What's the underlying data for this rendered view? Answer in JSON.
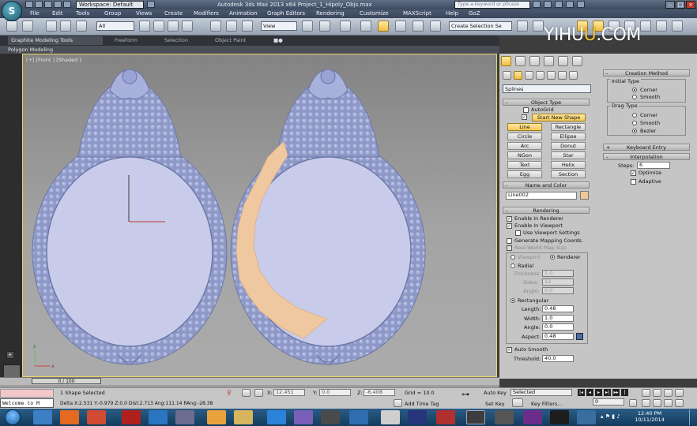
{
  "titlebar": {
    "workspace": "Workspace: Default",
    "app_title": "Autodesk 3ds Max 2013 x64      Project_1_Hipoly_Objs.max",
    "search_placeholder": "Type a keyword or phrase",
    "win_min": "–",
    "win_max": "□",
    "win_close": "×"
  },
  "menu": [
    "File",
    "Edit",
    "Tools",
    "Group",
    "Views",
    "Create",
    "Modifiers",
    "Animation",
    "Graph Editors",
    "Rendering",
    "Customize",
    "MAXScript",
    "Help",
    "GoZ"
  ],
  "toolbar": {
    "filter": "All",
    "ref_coord": "View",
    "selection_set": "Create Selection Se"
  },
  "ribbon": {
    "tabs": [
      "Graphite Modeling Tools",
      "Freeform",
      "Selection",
      "Object Paint"
    ],
    "sub": "Polygon Modeling"
  },
  "viewport": {
    "label": "[+] [Front ] [Shaded ]"
  },
  "cmd": {
    "category": "Splines",
    "object_type": {
      "title": "Object Type",
      "autogrid": "AutoGrid",
      "start_new_shape": "Start New Shape",
      "buttons": [
        [
          "Line",
          "Rectangle"
        ],
        [
          "Circle",
          "Ellipse"
        ],
        [
          "Arc",
          "Donut"
        ],
        [
          "NGon",
          "Star"
        ],
        [
          "Text",
          "Helix"
        ],
        [
          "Egg",
          "Section"
        ]
      ]
    },
    "name_color": {
      "title": "Name and Color",
      "name": "Line002",
      "color": "#f2c89a"
    },
    "rendering": {
      "title": "Rendering",
      "enable_renderer": "Enable In Renderer",
      "enable_viewport": "Enable In Viewport",
      "use_viewport_settings": "Use Viewport Settings",
      "gen_mapping": "Generate Mapping Coords.",
      "real_world": "Real-World Map Size",
      "viewport_opt": "Viewport",
      "renderer_opt": "Renderer",
      "radial": "Radial",
      "thickness_label": "Thickness:",
      "thickness": "1.0",
      "sides_label": "Sides:",
      "sides": "12",
      "angle_label": "Angle:",
      "angle": "0.0",
      "rectangular": "Rectangular",
      "length_label": "Length:",
      "length": "0.48",
      "width_label": "Width:",
      "width": "1.0",
      "rangle_label": "Angle:",
      "rangle": "0.0",
      "aspect_label": "Aspect:",
      "aspect": "0.48",
      "auto_smooth": "Auto Smooth",
      "threshold_label": "Threshold:",
      "threshold": "40.0"
    },
    "creation_method": {
      "title": "Creation Method",
      "initial_type": "Initial Type",
      "corner": "Corner",
      "smooth": "Smooth",
      "drag_type": "Drag Type",
      "d_corner": "Corner",
      "d_smooth": "Smooth",
      "d_bezier": "Bezier"
    },
    "keyboard_entry": "Keyboard Entry",
    "interpolation": {
      "title": "Interpolation",
      "steps_label": "Steps:",
      "steps": "6",
      "optimize": "Optimize",
      "adaptive": "Adaptive"
    }
  },
  "timeline": {
    "frame": "0 / 100"
  },
  "status": {
    "maxscript": "Welcome to M",
    "selected": "1 Shape Selected",
    "prompt": "Delta X:2.531  Y:-0.979  Z:0.0  Dist:2.713  Ang:111.14  RAng:-28.38",
    "x_label": "X:",
    "x": "12.451",
    "y_label": "Y:",
    "y": "0.0",
    "z_label": "Z:",
    "z": "-6.408",
    "grid": "Grid = 10.0",
    "add_time_tag": "Add Time Tag",
    "auto_key": "Auto Key",
    "set_key": "Set Key",
    "selected_dd": "Selected",
    "key_filters": "Key Filters...",
    "frame_field": "0"
  },
  "taskbar": {
    "time": "12:40 PM",
    "date": "10/11/2014"
  },
  "watermark": {
    "left": "YIHU",
    "mid": "U",
    "right": ".COM"
  }
}
